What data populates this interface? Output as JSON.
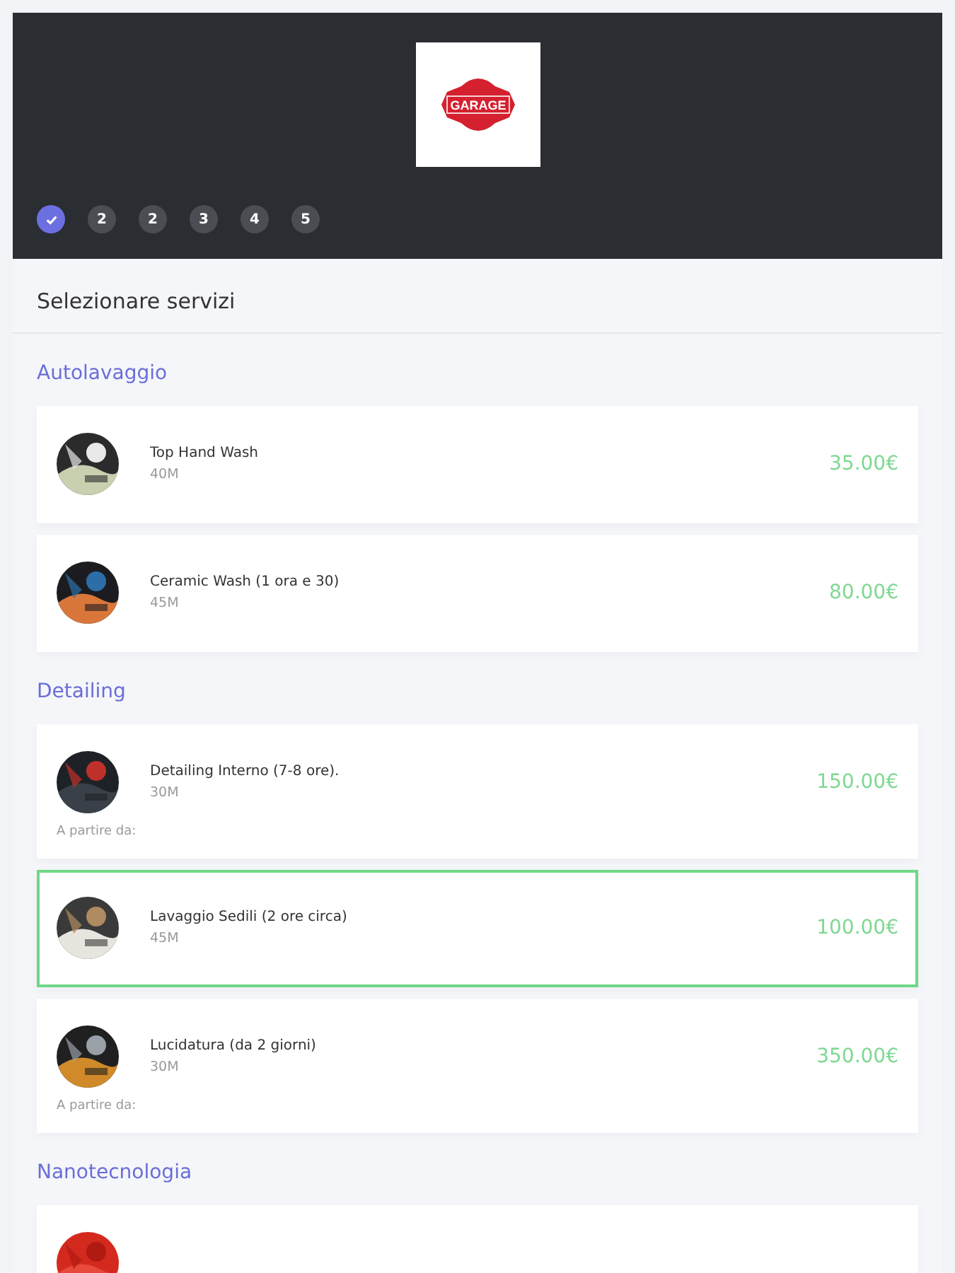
{
  "header": {
    "logo": {
      "text": "GARAGE"
    },
    "steps": [
      {
        "kind": "done",
        "selected": true
      },
      {
        "kind": "number",
        "label": "2",
        "selected": false
      },
      {
        "kind": "number",
        "label": "2",
        "selected": false
      },
      {
        "kind": "number",
        "label": "3",
        "selected": false
      },
      {
        "kind": "number",
        "label": "4",
        "selected": false
      },
      {
        "kind": "number",
        "label": "5",
        "selected": false
      }
    ]
  },
  "title": "Selezionare servizi",
  "categories": [
    {
      "name": "Autolavaggio",
      "services": [
        {
          "name": "Top Hand Wash",
          "duration": "40M",
          "price": "35.00€",
          "selected": false
        },
        {
          "name": "Ceramic Wash (1 ora e 30)",
          "duration": "45M",
          "price": "80.00€",
          "selected": false
        }
      ]
    },
    {
      "name": "Detailing",
      "services": [
        {
          "name": "Detailing Interno (7-8 ore).",
          "duration": "30M",
          "price": "150.00€",
          "note": "A partire da:",
          "selected": false
        },
        {
          "name": "Lavaggio Sedili (2 ore circa)",
          "duration": "45M",
          "price": "100.00€",
          "selected": true
        },
        {
          "name": "Lucidatura (da 2 giorni)",
          "duration": "30M",
          "price": "350.00€",
          "note": "A partire da:",
          "selected": false
        }
      ]
    },
    {
      "name": "Nanotecnologia",
      "services": [
        {
          "selected": false
        }
      ]
    }
  ]
}
